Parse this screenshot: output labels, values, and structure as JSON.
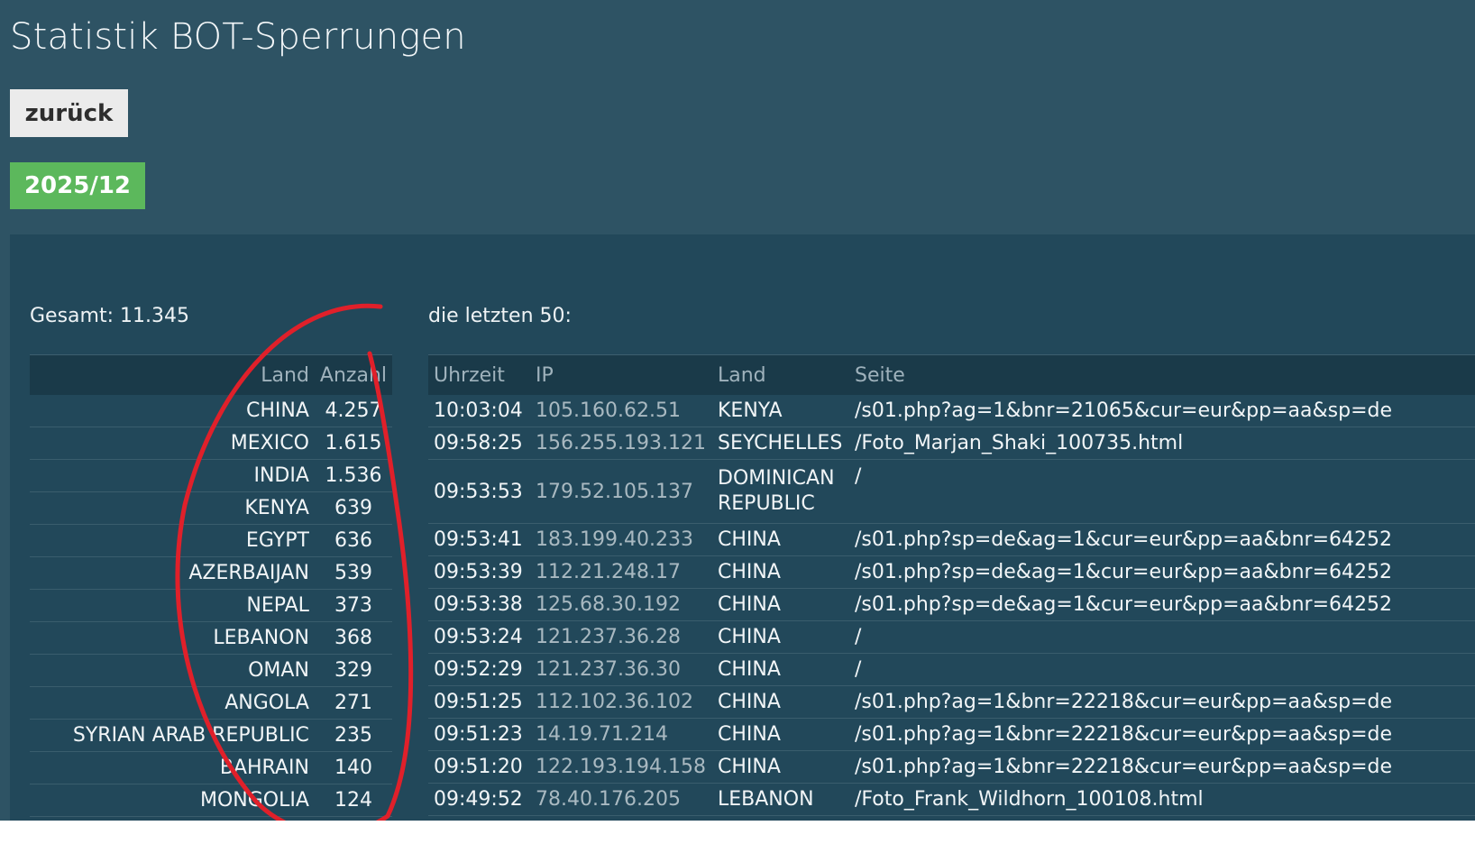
{
  "header": {
    "title": "Statistik BOT-Sperrungen",
    "back_label": "zurück",
    "month_label": "2025/12"
  },
  "summary": {
    "total_label": "Gesamt: 11.345",
    "recent_label": "die letzten 50:"
  },
  "countries_table": {
    "headers": [
      "Land",
      "Anzahl"
    ],
    "rows": [
      {
        "land": "CHINA",
        "anzahl": "4.257"
      },
      {
        "land": "MEXICO",
        "anzahl": "1.615"
      },
      {
        "land": "INDIA",
        "anzahl": "1.536"
      },
      {
        "land": "KENYA",
        "anzahl": "639"
      },
      {
        "land": "EGYPT",
        "anzahl": "636"
      },
      {
        "land": "AZERBAIJAN",
        "anzahl": "539"
      },
      {
        "land": "NEPAL",
        "anzahl": "373"
      },
      {
        "land": "LEBANON",
        "anzahl": "368"
      },
      {
        "land": "OMAN",
        "anzahl": "329"
      },
      {
        "land": "ANGOLA",
        "anzahl": "271"
      },
      {
        "land": "SYRIAN ARAB REPUBLIC",
        "anzahl": "235"
      },
      {
        "land": "BAHRAIN",
        "anzahl": "140"
      },
      {
        "land": "MONGOLIA",
        "anzahl": "124"
      }
    ]
  },
  "log_table": {
    "headers": [
      "Uhrzeit",
      "IP",
      "Land",
      "Seite"
    ],
    "rows": [
      {
        "uhrzeit": "10:03:04",
        "ip": "105.160.62.51",
        "land": "KENYA",
        "seite": "/s01.php?ag=1&bnr=21065&cur=eur&pp=aa&sp=de"
      },
      {
        "uhrzeit": "09:58:25",
        "ip": "156.255.193.121",
        "land": "SEYCHELLES",
        "seite": "/Foto_Marjan_Shaki_100735.html"
      },
      {
        "uhrzeit": "09:53:53",
        "ip": "179.52.105.137",
        "land": "DOMINICAN REPUBLIC",
        "seite": "/"
      },
      {
        "uhrzeit": "09:53:41",
        "ip": "183.199.40.233",
        "land": "CHINA",
        "seite": "/s01.php?sp=de&ag=1&cur=eur&pp=aa&bnr=64252"
      },
      {
        "uhrzeit": "09:53:39",
        "ip": "112.21.248.17",
        "land": "CHINA",
        "seite": "/s01.php?sp=de&ag=1&cur=eur&pp=aa&bnr=64252"
      },
      {
        "uhrzeit": "09:53:38",
        "ip": "125.68.30.192",
        "land": "CHINA",
        "seite": "/s01.php?sp=de&ag=1&cur=eur&pp=aa&bnr=64252"
      },
      {
        "uhrzeit": "09:53:24",
        "ip": "121.237.36.28",
        "land": "CHINA",
        "seite": "/"
      },
      {
        "uhrzeit": "09:52:29",
        "ip": "121.237.36.30",
        "land": "CHINA",
        "seite": "/"
      },
      {
        "uhrzeit": "09:51:25",
        "ip": "112.102.36.102",
        "land": "CHINA",
        "seite": "/s01.php?ag=1&bnr=22218&cur=eur&pp=aa&sp=de"
      },
      {
        "uhrzeit": "09:51:23",
        "ip": "14.19.71.214",
        "land": "CHINA",
        "seite": "/s01.php?ag=1&bnr=22218&cur=eur&pp=aa&sp=de"
      },
      {
        "uhrzeit": "09:51:20",
        "ip": "122.193.194.158",
        "land": "CHINA",
        "seite": "/s01.php?ag=1&bnr=22218&cur=eur&pp=aa&sp=de"
      },
      {
        "uhrzeit": "09:49:52",
        "ip": "78.40.176.205",
        "land": "LEBANON",
        "seite": "/Foto_Frank_Wildhorn_100108.html"
      }
    ]
  },
  "annotation": {
    "color": "#e0202a"
  }
}
